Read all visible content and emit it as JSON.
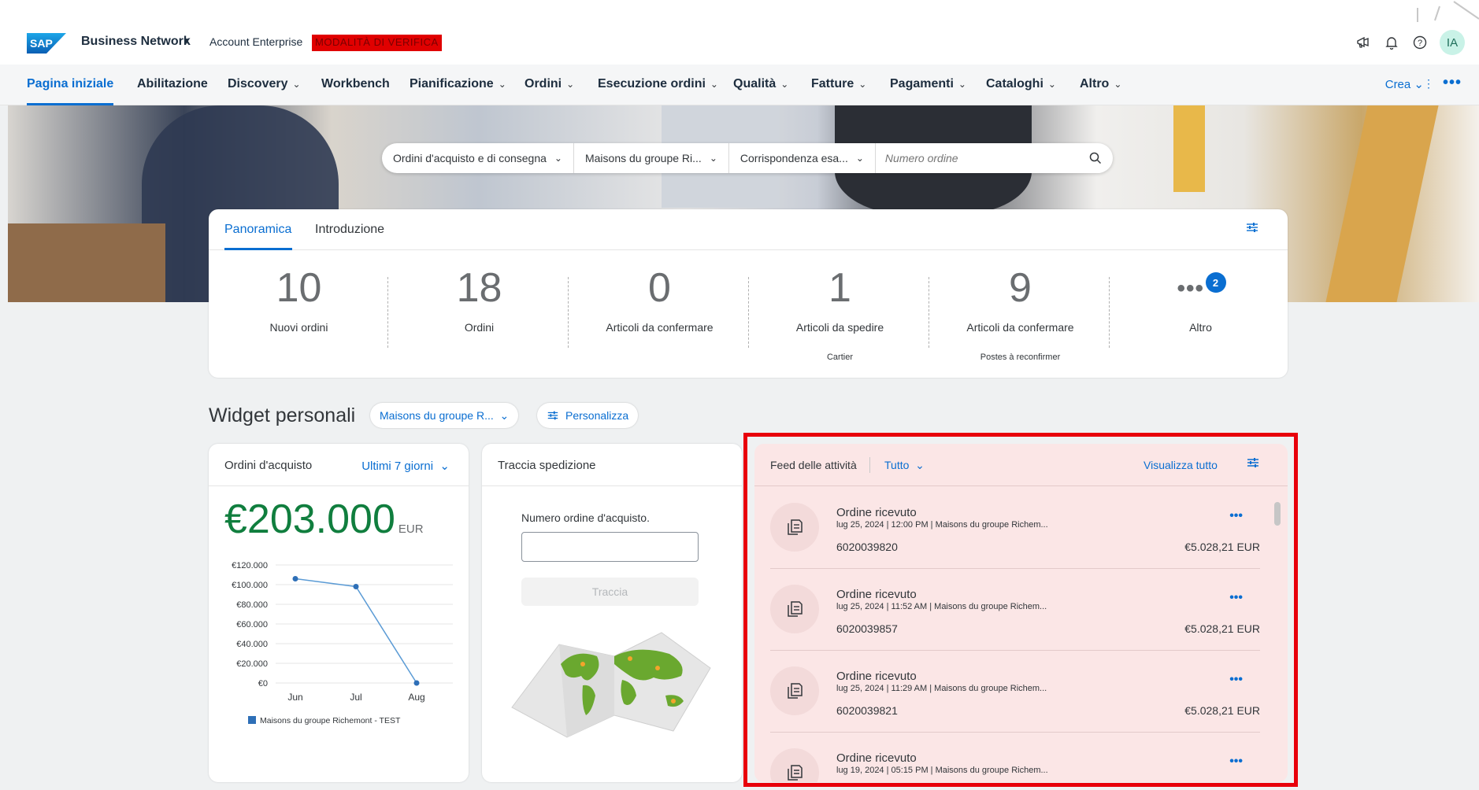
{
  "shell": {
    "logo_text": "SAP",
    "product": "Business Network",
    "account": "Account Enterprise",
    "mode_badge": "MODALITÀ DI VERIFICA",
    "avatar": "IA",
    "icons": [
      "megaphone-icon",
      "bell-icon",
      "help-icon"
    ]
  },
  "nav": {
    "items": [
      {
        "label": "Pagina iniziale",
        "active": true
      },
      {
        "label": "Abilitazione"
      },
      {
        "label": "Discovery"
      },
      {
        "label": "Workbench"
      },
      {
        "label": "Pianificazione"
      },
      {
        "label": "Ordini"
      },
      {
        "label": "Esecuzione ordini"
      },
      {
        "label": "Qualità"
      },
      {
        "label": "Fatture"
      },
      {
        "label": "Pagamenti"
      },
      {
        "label": "Cataloghi"
      },
      {
        "label": "Altro"
      }
    ],
    "create": "Crea"
  },
  "search": {
    "document_type": "Ordini d'acquisto e di consegna",
    "customer": "Maisons du groupe Ri...",
    "match": "Corrispondenza esa...",
    "placeholder": "Numero ordine"
  },
  "overview": {
    "tabs": [
      "Panoramica",
      "Introduzione"
    ],
    "kpis": [
      {
        "value": "10",
        "label": "Nuovi ordini",
        "sub": ""
      },
      {
        "value": "18",
        "label": "Ordini",
        "sub": ""
      },
      {
        "value": "0",
        "label": "Articoli da confermare",
        "sub": ""
      },
      {
        "value": "1",
        "label": "Articoli da spedire",
        "sub": "Cartier"
      },
      {
        "value": "9",
        "label": "Articoli da confermare",
        "sub": "Postes à reconfirmer"
      }
    ],
    "more": {
      "label": "Altro",
      "badge": "2"
    }
  },
  "widgets": {
    "title": "Widget personali",
    "customer_filter": "Maisons du groupe R...",
    "customize": "Personalizza"
  },
  "orders_card": {
    "title": "Ordini d'acquisto",
    "period": "Ultimi 7 giorni",
    "amount": "€203.000",
    "currency": "EUR"
  },
  "chart_data": {
    "type": "line",
    "categories": [
      "Jun",
      "Jul",
      "Aug"
    ],
    "series": [
      {
        "name": "Maisons du groupe Richemont - TEST",
        "values": [
          106000,
          98000,
          0
        ],
        "color": "#5b9bd5"
      }
    ],
    "ylim": [
      0,
      120000
    ],
    "yticks": [
      "€0",
      "€20.000",
      "€40.000",
      "€60.000",
      "€80.000",
      "€100.000",
      "€120.000"
    ],
    "grid": true,
    "legend": "bottom"
  },
  "track_card": {
    "title": "Traccia spedizione",
    "input_label": "Numero ordine d'acquisto.",
    "button": "Traccia"
  },
  "feed": {
    "title": "Feed delle attività",
    "filter": "Tutto",
    "view_all": "Visualizza tutto",
    "items": [
      {
        "title": "Ordine ricevuto",
        "meta": "lug 25, 2024  |  12:00 PM  |  Maisons du groupe Richem...",
        "number": "6020039820",
        "amount": "€5.028,21 EUR"
      },
      {
        "title": "Ordine ricevuto",
        "meta": "lug 25, 2024  |  11:52 AM  |  Maisons du groupe Richem...",
        "number": "6020039857",
        "amount": "€5.028,21 EUR"
      },
      {
        "title": "Ordine ricevuto",
        "meta": "lug 25, 2024  |  11:29 AM  |  Maisons du groupe Richem...",
        "number": "6020039821",
        "amount": "€5.028,21 EUR"
      },
      {
        "title": "Ordine ricevuto",
        "meta": "lug 19, 2024  |  05:15 PM  |  Maisons du groupe Richem...",
        "number": "",
        "amount": ""
      }
    ]
  },
  "colors": {
    "accent": "#0a6ed1",
    "positive": "#107e3e",
    "highlight": "#e8000b"
  }
}
